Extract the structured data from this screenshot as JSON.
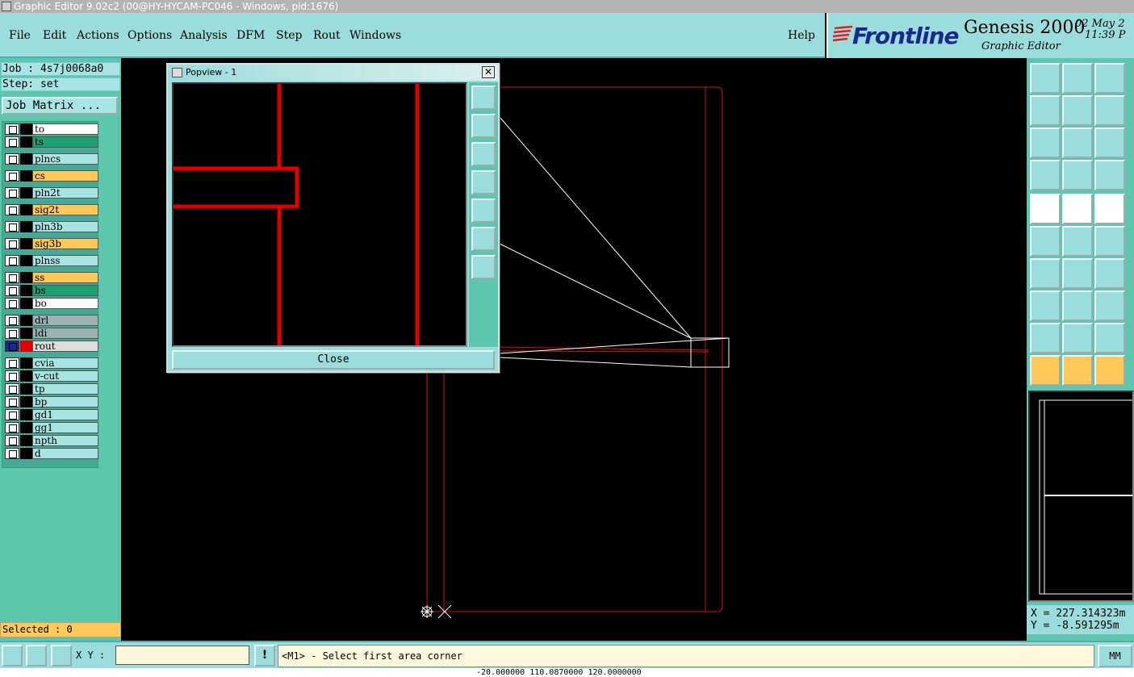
{
  "window": {
    "title": "Graphic Editor 9.02c2 (00@HY-HYCAM-PC046 - Windows, pid:1676)"
  },
  "menu": {
    "file": "File",
    "edit": "Edit",
    "actions": "Actions",
    "options": "Options",
    "analysis": "Analysis",
    "dfm": "DFM",
    "step": "Step",
    "rout": "Rout",
    "windows": "Windows",
    "help": "Help"
  },
  "brand": {
    "logo": "Frontline",
    "product": "Genesis 2000",
    "subtitle": "Graphic Editor",
    "date": "02 May 2",
    "time": "11:39 P"
  },
  "job": {
    "job_line": "Job : 4s7j0068a0",
    "step_line": "Step: set",
    "matrix_button": "Job Matrix ..."
  },
  "layers": [
    {
      "name": "to",
      "color": "#ffffff"
    },
    {
      "name": "ts",
      "color": "#20a070"
    },
    {
      "name": "plncs",
      "color": "#a8e4e4"
    },
    {
      "name": "cs",
      "color": "#ffc85a"
    },
    {
      "name": "pln2t",
      "color": "#a8e4e4"
    },
    {
      "name": "sig2t",
      "color": "#ffc85a"
    },
    {
      "name": "pln3b",
      "color": "#a8e4e4"
    },
    {
      "name": "sig3b",
      "color": "#ffc85a"
    },
    {
      "name": "plnss",
      "color": "#a8e4e4"
    },
    {
      "name": "ss",
      "color": "#ffc85a"
    },
    {
      "name": "bs",
      "color": "#20a070"
    },
    {
      "name": "bo",
      "color": "#ffffff"
    },
    {
      "name": "drl",
      "color": "#9ab4b4"
    },
    {
      "name": "ldi",
      "color": "#9ab4b4"
    },
    {
      "name": "rout",
      "color": "#dcdcdc"
    },
    {
      "name": "cvia",
      "color": "#a8e4e4"
    },
    {
      "name": "v-cut",
      "color": "#a8e4e4"
    },
    {
      "name": "tp",
      "color": "#a8e4e4"
    },
    {
      "name": "bp",
      "color": "#a8e4e4"
    },
    {
      "name": "gd1",
      "color": "#a8e4e4"
    },
    {
      "name": "gg1",
      "color": "#a8e4e4"
    },
    {
      "name": "npth",
      "color": "#a8e4e4"
    },
    {
      "name": "d",
      "color": "#a8e4e4"
    }
  ],
  "selected": "Selected : 0",
  "popview": {
    "title": "Popview - 1",
    "close_label": "Close",
    "close_icon": "close-icon"
  },
  "coords": {
    "x": "X = 227.314323m",
    "y": "Y = -8.591295m"
  },
  "bottom": {
    "xy_label": "X Y :",
    "xy_value": "",
    "prompt": "<M1> - Select first area corner",
    "unit": "MM",
    "status": "-20.000000  110.0870000  120.0000000"
  },
  "colors": {
    "panel": "#9bdcdc",
    "accent_teal": "#5ec6ae",
    "layer_orange": "#ffc85a",
    "trace_red": "#e00000"
  }
}
